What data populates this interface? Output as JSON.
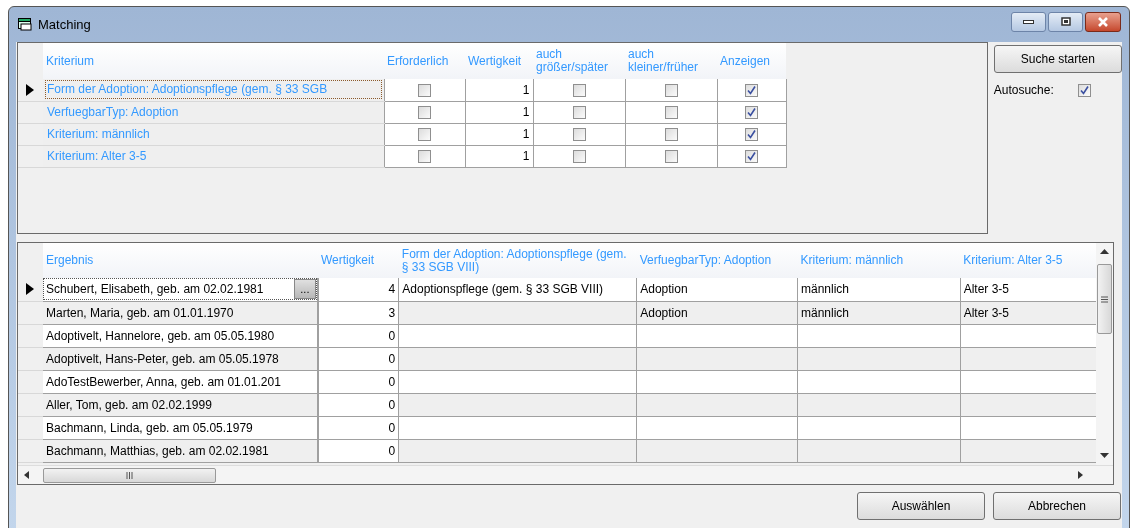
{
  "window": {
    "title": "Matching"
  },
  "criteria_table": {
    "columns": [
      "Kriterium",
      "Erforderlich",
      "Wertigkeit",
      "auch größer/später",
      "auch kleiner/früher",
      "Anzeigen"
    ],
    "rows": [
      {
        "selected": true,
        "criterion": "Form der Adoption: Adoptionspflege (gem. § 33 SGB",
        "required": false,
        "weight": "1",
        "also_greater": false,
        "also_smaller": false,
        "show": true
      },
      {
        "selected": false,
        "criterion": "VerfuegbarTyp: Adoption",
        "required": false,
        "weight": "1",
        "also_greater": false,
        "also_smaller": false,
        "show": true
      },
      {
        "selected": false,
        "criterion": "Kriterium: männlich",
        "required": false,
        "weight": "1",
        "also_greater": false,
        "also_smaller": false,
        "show": true
      },
      {
        "selected": false,
        "criterion": "Kriterium: Alter 3-5",
        "required": false,
        "weight": "1",
        "also_greater": false,
        "also_smaller": false,
        "show": true
      }
    ]
  },
  "search_button": "Suche starten",
  "autosearch": {
    "label": "Autosuche:",
    "checked": true
  },
  "results_table": {
    "columns": [
      "Ergebnis",
      "Wertigkeit",
      "Form der Adoption: Adoptionspflege (gem. § 33 SGB VIII)",
      "VerfuegbarTyp: Adoption",
      "Kriterium: männlich",
      "Kriterium: Alter 3-5"
    ],
    "rows": [
      {
        "selected": true,
        "name": "Schubert, Elisabeth, geb. am 02.02.1981",
        "detail_button": "...",
        "weight": "4",
        "form": "Adoptionspflege (gem. § 33 SGB VIII)",
        "type": "Adoption",
        "gender": "männlich",
        "age": "Alter 3-5"
      },
      {
        "selected": false,
        "name": "Marten, Maria, geb. am 01.01.1970",
        "weight": "3",
        "type": "Adoption",
        "gender": "männlich",
        "age": "Alter 3-5"
      },
      {
        "selected": false,
        "name": "Adoptivelt, Hannelore, geb. am 05.05.1980",
        "weight": "0"
      },
      {
        "selected": false,
        "name": "Adoptivelt, Hans-Peter, geb. am 05.05.1978",
        "weight": "0"
      },
      {
        "selected": false,
        "name": "AdoTestBewerber, Anna, geb. am 01.01.201",
        "weight": "0"
      },
      {
        "selected": false,
        "name": "Aller, Tom, geb. am 02.02.1999",
        "weight": "0"
      },
      {
        "selected": false,
        "name": "Bachmann, Linda, geb. am 05.05.1979",
        "weight": "0"
      },
      {
        "selected": false,
        "name": "Bachmann, Matthias, geb. am 02.02.1981",
        "weight": "0"
      }
    ]
  },
  "buttons": [
    {
      "label": "Auswählen"
    },
    {
      "label": "Abbrechen"
    }
  ]
}
